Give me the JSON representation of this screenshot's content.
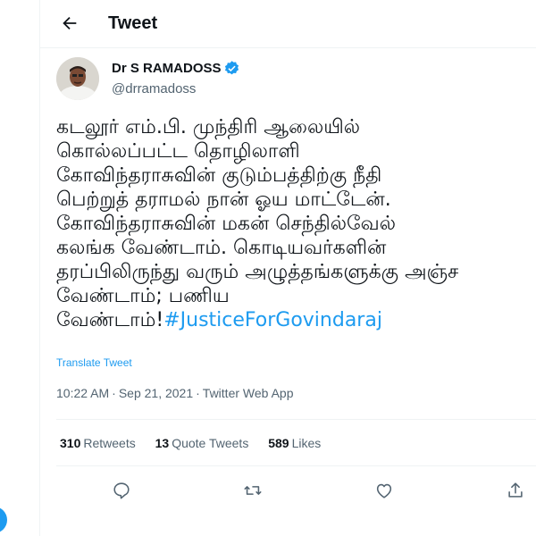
{
  "header": {
    "title": "Tweet",
    "back_icon": "back-arrow-icon"
  },
  "author": {
    "name": "Dr S RAMADOSS",
    "handle": "@drramadoss",
    "verified": true,
    "verified_color": "#1d9bf0"
  },
  "tweet": {
    "lines": [
      "கடலூர் எம்.பி. முந்திரி ஆலையில்",
      "கொல்லப்பட்ட தொழிலாளி",
      "கோவிந்தராசுவின் குடும்பத்திற்கு நீதி",
      "பெற்றுத் தராமல் நான் ஓய மாட்டேன்.",
      "கோவிந்தராசுவின் மகன் செந்தில்வேல்",
      "கலங்க வேண்டாம். கொடியவர்களின்",
      "தரப்பிலிருந்து வரும் அழுத்தங்களுக்கு அஞ்ச",
      "வேண்டாம்; பணிய"
    ],
    "last_line_prefix": "வேண்டாம்!",
    "hashtag": "#JusticeForGovindaraj",
    "translate_label": "Translate Tweet",
    "time": "10:22 AM",
    "date": "Sep 21, 2021",
    "separator": "·",
    "source": "Twitter Web App"
  },
  "stats": {
    "retweets_count": "310",
    "retweets_label": "Retweets",
    "quotes_count": "13",
    "quotes_label": "Quote Tweets",
    "likes_count": "589",
    "likes_label": "Likes"
  },
  "actions": [
    {
      "icon": "reply-icon"
    },
    {
      "icon": "retweet-icon"
    },
    {
      "icon": "like-icon"
    },
    {
      "icon": "share-icon"
    }
  ],
  "colors": {
    "accent": "#1d9bf0",
    "secondary_text": "#536471",
    "primary_text": "#0f1419"
  }
}
